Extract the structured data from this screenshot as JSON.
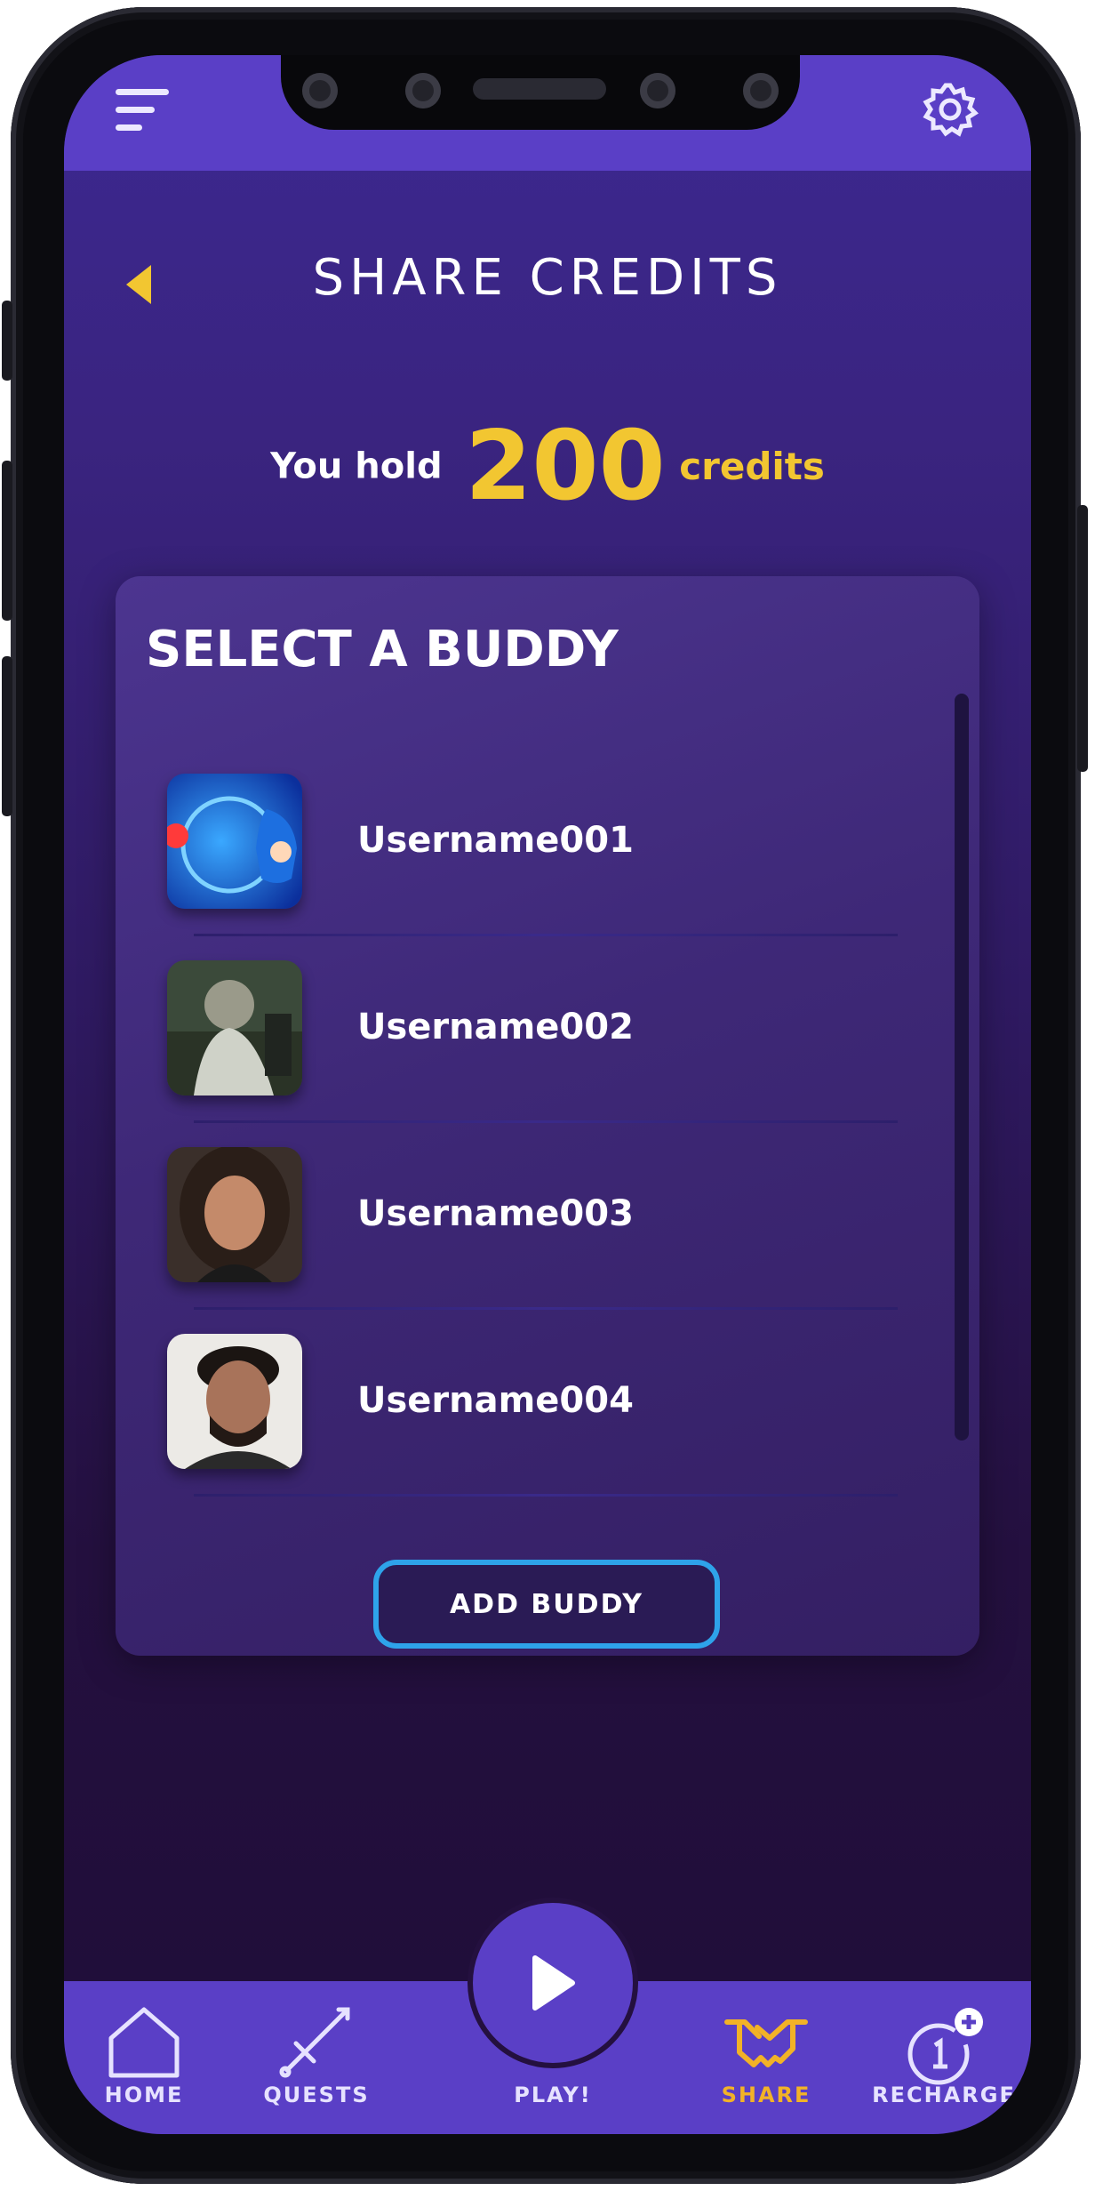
{
  "header": {
    "title": "SHARE CREDITS",
    "menu_icon": "menu-icon",
    "settings_icon": "gear-icon",
    "back_icon": "back-arrow-icon"
  },
  "credits": {
    "label": "You hold",
    "value": "200",
    "unit": "credits"
  },
  "buddy_panel": {
    "title": "SELECT A BUDDY",
    "buddies": [
      {
        "username": "Username001"
      },
      {
        "username": "Username002"
      },
      {
        "username": "Username003"
      },
      {
        "username": "Username004"
      }
    ],
    "add_button_label": "ADD BUDDY"
  },
  "tabbar": {
    "tabs": [
      {
        "label": "HOME",
        "icon": "home-icon"
      },
      {
        "label": "QUESTS",
        "icon": "sword-icon"
      },
      {
        "label": "PLAY!",
        "icon": "play-icon"
      },
      {
        "label": "SHARE",
        "icon": "handshake-icon",
        "active": true
      },
      {
        "label": "RECHARGE",
        "icon": "recharge-icon"
      }
    ]
  },
  "colors": {
    "accent": "#f2c631",
    "bar": "#5a3fc6",
    "button_border": "#2ea3ea",
    "active_tab": "#f2b227"
  }
}
